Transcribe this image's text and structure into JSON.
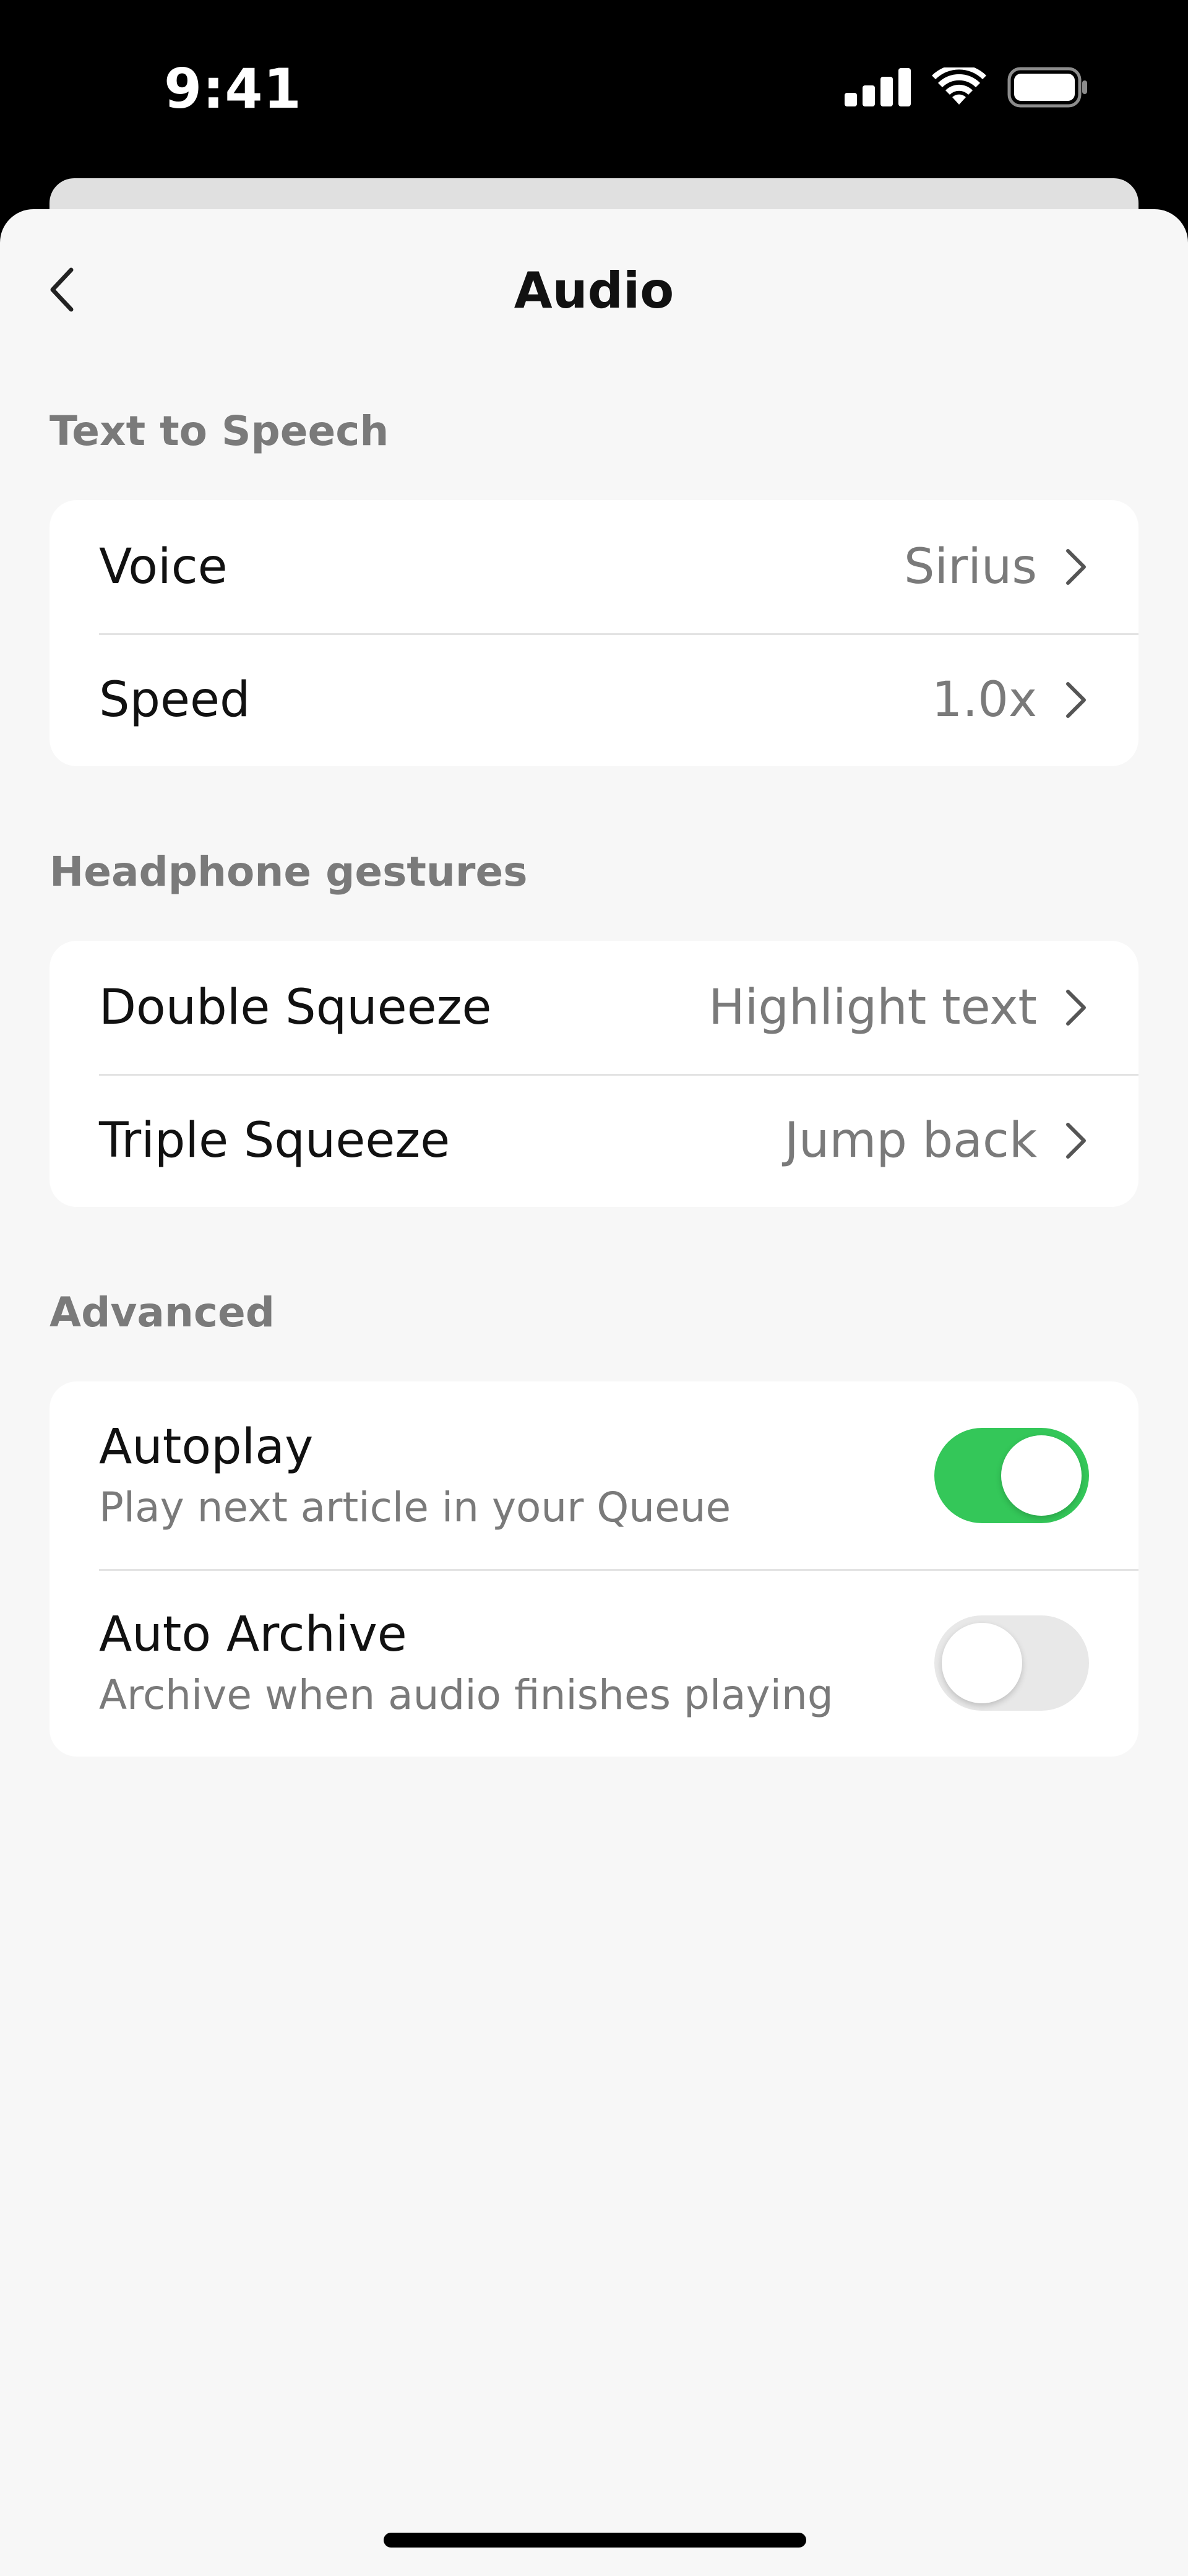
{
  "status_bar": {
    "time": "9:41"
  },
  "nav": {
    "title": "Audio"
  },
  "sections": {
    "tts": {
      "header": "Text to Speech",
      "voice": {
        "label": "Voice",
        "value": "Sirius"
      },
      "speed": {
        "label": "Speed",
        "value": "1.0x"
      }
    },
    "headphone": {
      "header": "Headphone gestures",
      "double_squeeze": {
        "label": "Double Squeeze",
        "value": "Highlight text"
      },
      "triple_squeeze": {
        "label": "Triple Squeeze",
        "value": "Jump back"
      }
    },
    "advanced": {
      "header": "Advanced",
      "autoplay": {
        "label": "Autoplay",
        "subtitle": "Play next article in your Queue",
        "enabled": true
      },
      "auto_archive": {
        "label": "Auto Archive",
        "subtitle": "Archive when audio finishes playing",
        "enabled": false
      }
    }
  },
  "colors": {
    "toggle_on": "#34c759",
    "toggle_off": "#e8e8e8",
    "sheet_bg": "#f7f7f7",
    "secondary_text": "#7a7a7a"
  },
  "icons": {
    "back": "chevron-left-icon",
    "disclosure": "chevron-right-icon",
    "signal": "cellular-signal-icon",
    "wifi": "wifi-icon",
    "battery": "battery-icon"
  }
}
